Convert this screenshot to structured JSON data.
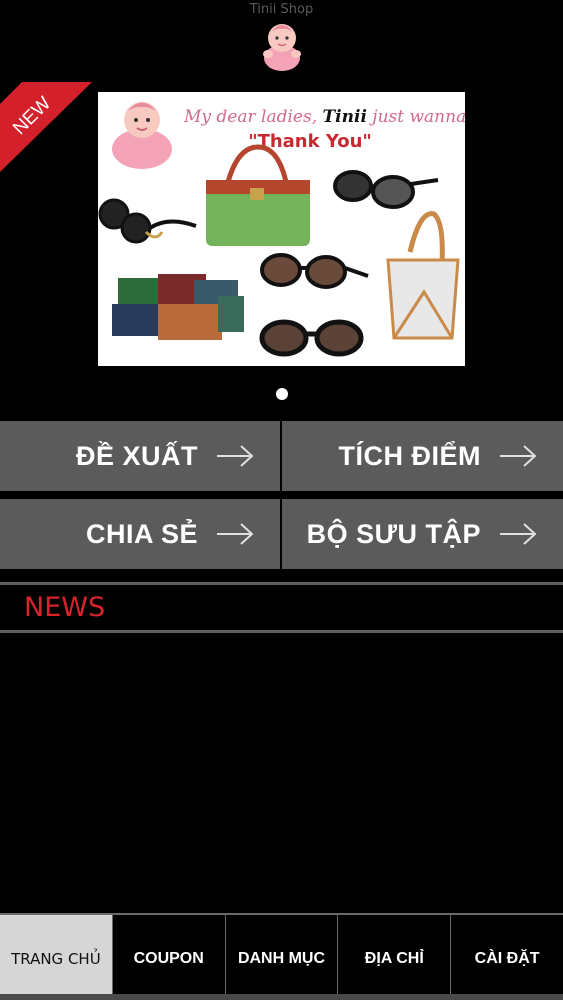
{
  "app": {
    "title": "Tinii Shop"
  },
  "banner": {
    "badge": "NEW",
    "headline_prefix": "My dear ladies, ",
    "headline_brand": "Tinii",
    "headline_suffix": " just wanna say",
    "headline_quote": "\"Thank You\"",
    "slide_count": 1,
    "active_slide": 1
  },
  "menu": {
    "de_xuat": "ĐỀ XUẤT",
    "tich_diem": "TÍCH ĐIỂM",
    "chia_se": "CHIA SẺ",
    "bo_suu_tap": "BỘ SƯU TẬP"
  },
  "news": {
    "title": "NEWS"
  },
  "tabs": {
    "home": "TRANG CHỦ",
    "coupon": "COUPON",
    "category": "DANH MỤC",
    "address": "ĐỊA CHỈ",
    "settings": "CÀI ĐẶT"
  },
  "colors": {
    "background": "#000000",
    "tile": "#5b5b5b",
    "news_red": "#d8232a",
    "ribbon_red": "#d3202a",
    "active_tab": "#d6d6d6"
  }
}
